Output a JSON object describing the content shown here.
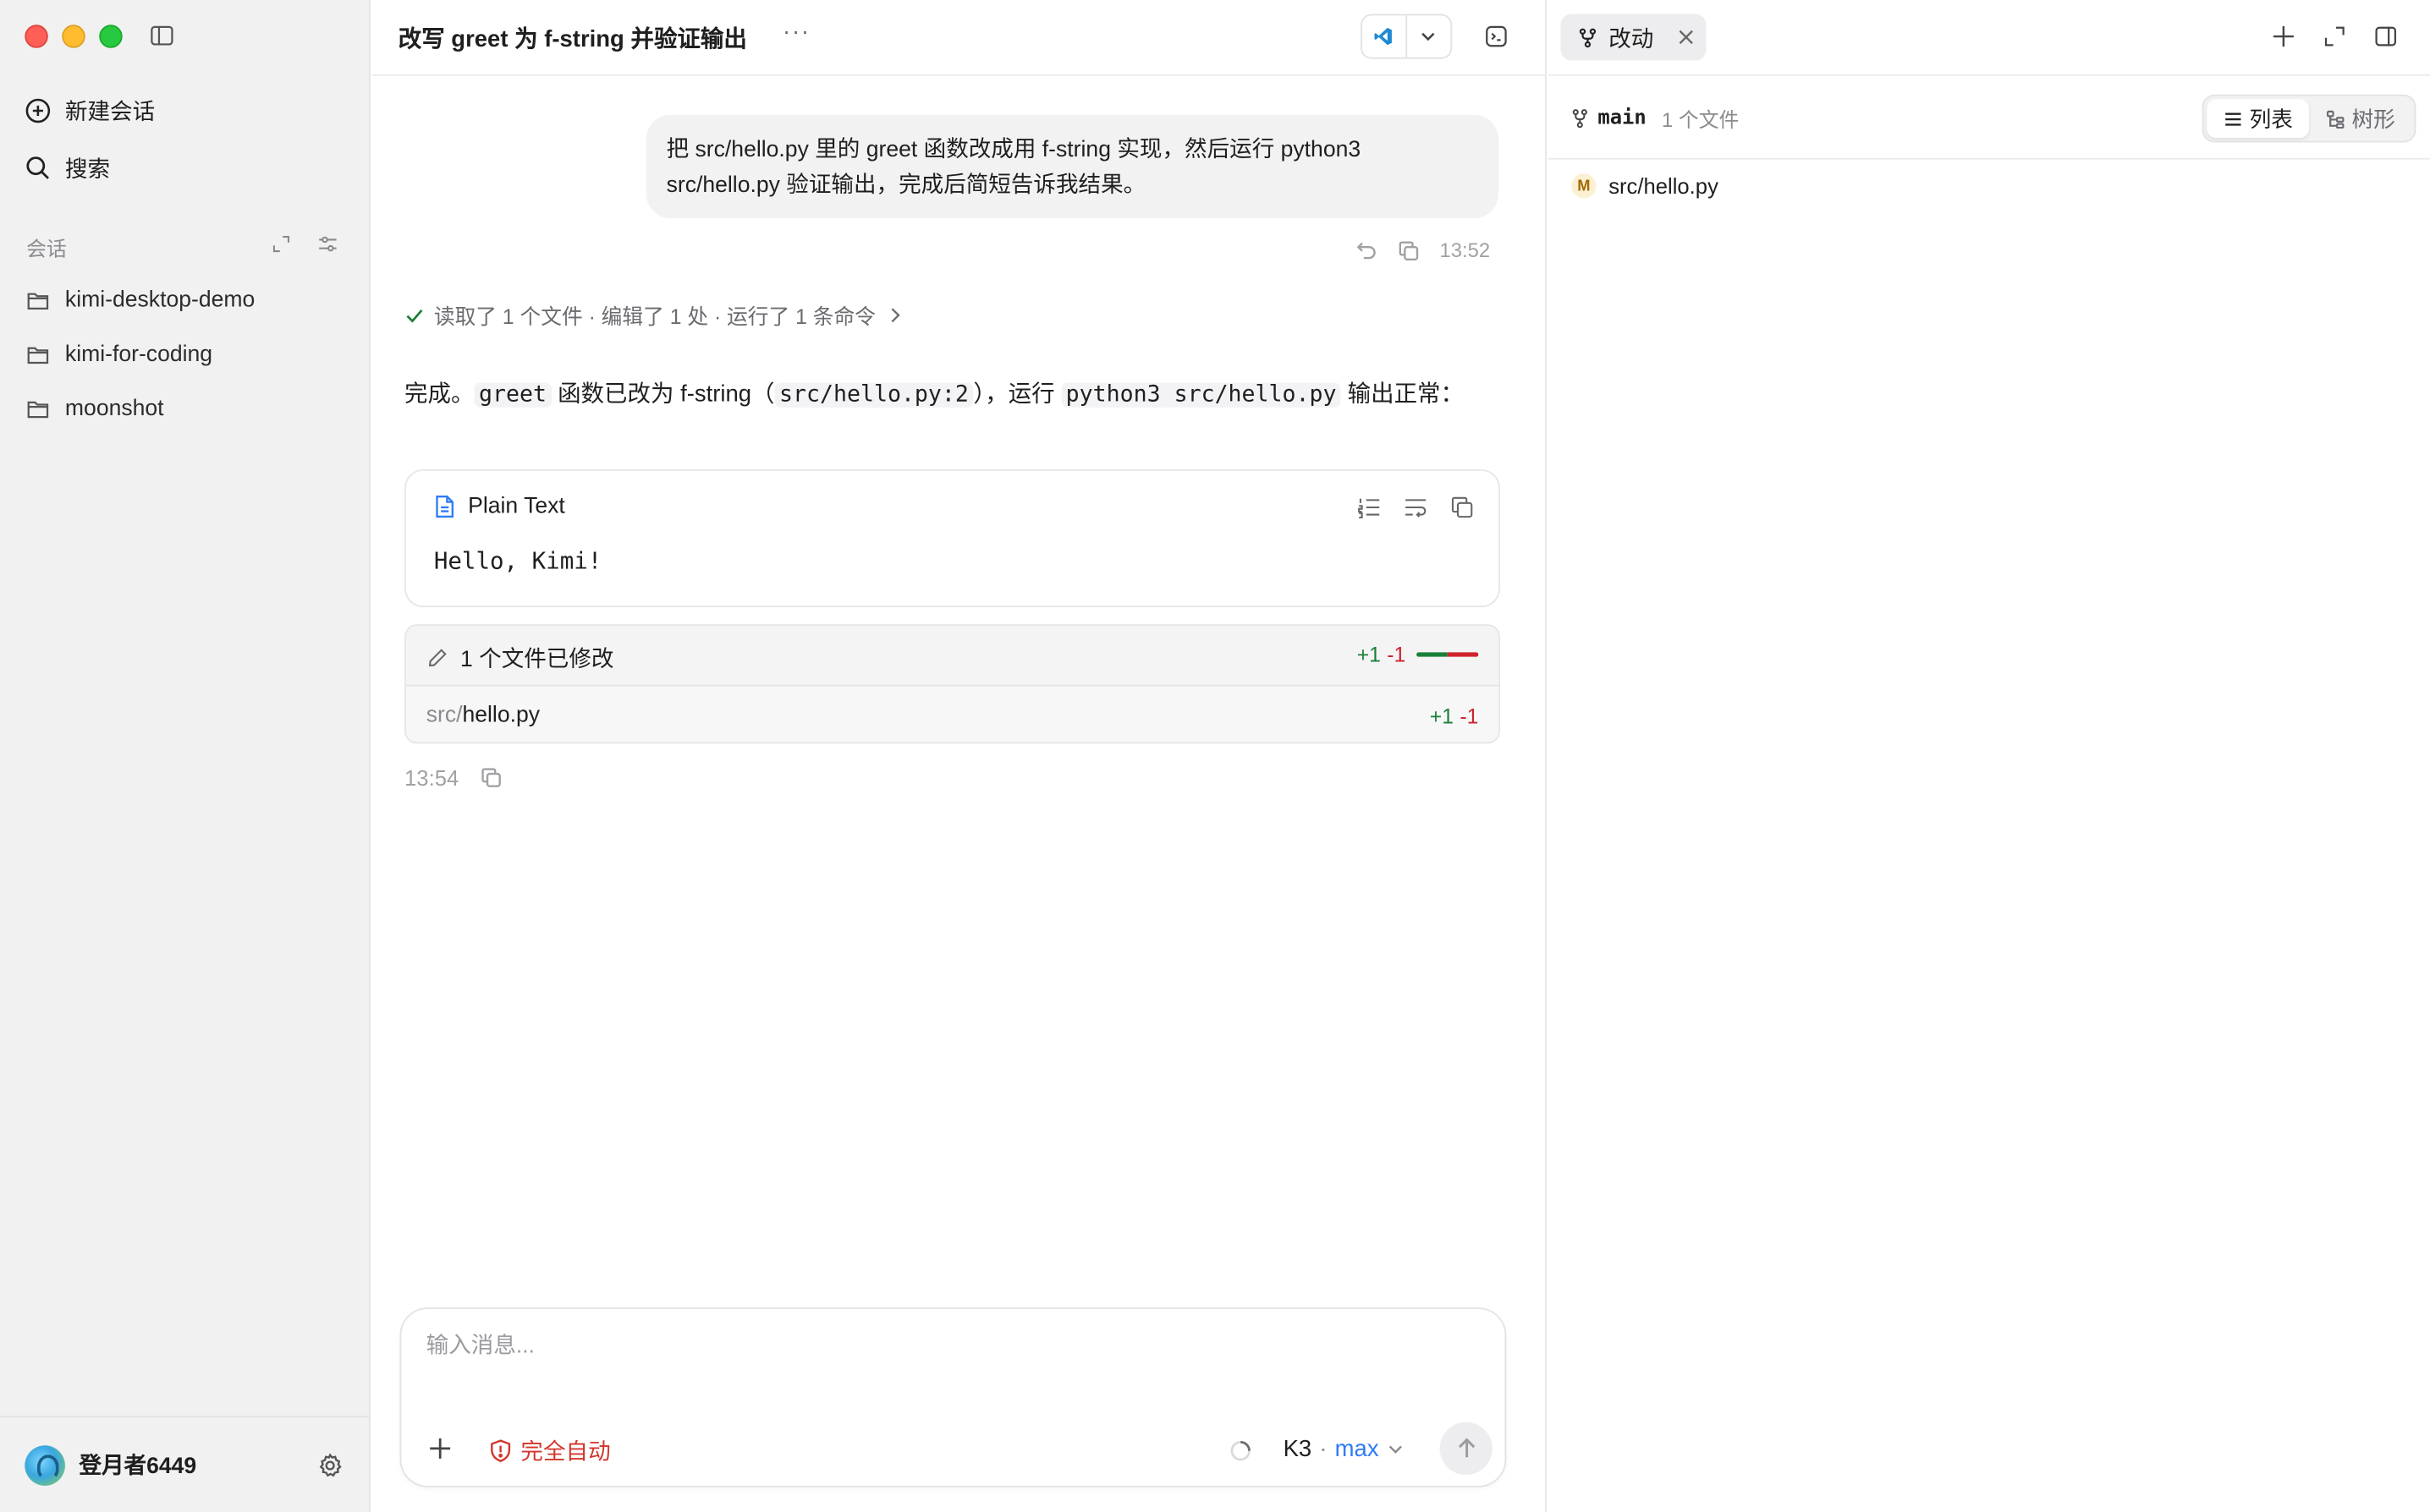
{
  "sidebar": {
    "new_chat_label": "新建会话",
    "search_label": "搜索",
    "section_label": "会话",
    "projects": [
      {
        "label": "kimi-desktop-demo"
      },
      {
        "label": "kimi-for-coding"
      },
      {
        "label": "moonshot"
      }
    ],
    "user_name": "登月者6449"
  },
  "chat": {
    "title": "改写 greet 为 f-string 并验证输出",
    "more_label": "···",
    "user_message": "把 src/hello.py 里的 greet 函数改成用 f-string 实现，然后运行 python3 src/hello.py 验证输出，完成后简短告诉我结果。",
    "user_time": "13:52",
    "summary": "读取了 1 个文件 · 编辑了 1 处 · 运行了 1 条命令",
    "answer": {
      "p1": "完成。",
      "c1": "greet",
      "p2": " 函数已改为 f-string（",
      "c2": "src/hello.py:2",
      "p3": "），运行 ",
      "c3": "python3 src/hello.py",
      "p4": " 输出正常："
    },
    "code_block": {
      "language": "Plain Text",
      "content": "Hello, Kimi!"
    },
    "diff": {
      "title": "1 个文件已修改",
      "additions": "+1",
      "deletions": "-1",
      "file_dir": "src/",
      "file_name": "hello.py",
      "file_additions": "+1",
      "file_deletions": "-1"
    },
    "answer_time": "13:54"
  },
  "composer": {
    "placeholder": "输入消息...",
    "mode_label": "完全自动",
    "model_name": "K3",
    "model_separator": "·",
    "model_mode": "max"
  },
  "panel": {
    "tab_label": "改动",
    "branch": "main",
    "file_count": "1 个文件",
    "view_list": "列表",
    "view_tree": "树形",
    "files": [
      {
        "status": "M",
        "path": "src/hello.py"
      }
    ]
  },
  "colors": {
    "accent": "#2f7cf6",
    "danger": "#d2352b",
    "add": "#1a7f37",
    "delete": "#cf222e"
  }
}
